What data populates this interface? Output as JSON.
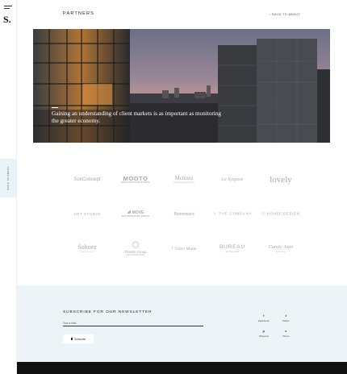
{
  "rail": {
    "logo": "S.",
    "back_tab": "BACK TO ABOUT"
  },
  "header": {
    "title": "PARTNERS",
    "back_link": "BACK TO ABOUT"
  },
  "hero": {
    "caption": "Gaining an understanding of client markets is as important as monitoring the greater economy."
  },
  "clients": {
    "row1": [
      "SonConcept",
      "MOOTO",
      "Mctinez",
      "Le Syspose",
      "lovely"
    ],
    "row1_sub": {
      "mooto": "ARCHITECTURE STUDIO",
      "mctinez": "INTERIOR DESIGN"
    },
    "row2": [
      "ART STUDIO",
      "MOVE",
      "Benimward",
      "THE COMPANY",
      "HOUSE DESIGN"
    ],
    "row2_sub": {
      "move": "ARCHITECTURE GROUP"
    },
    "row3": [
      "Sohoez",
      "Thaste Group",
      "Tailor Made",
      "BUREAU",
      "Candy Jane"
    ],
    "row3_sub": {
      "sohoez": "architecture",
      "thaste": "ARCHITECTURE",
      "bureau": "architecture",
      "candy": "STUDIO"
    }
  },
  "newsletter": {
    "title": "SUBSCRIBE FOR OUR NEWSLETTER",
    "email_placeholder": "Your e-mail...",
    "subscribe_label": "Subscribe"
  },
  "socials": [
    {
      "icon": "f",
      "label": "Facebook"
    },
    {
      "icon": "t",
      "label": "Twitter"
    },
    {
      "icon": "p",
      "label": "Pinterest"
    },
    {
      "icon": "v",
      "label": "Vimeo"
    }
  ],
  "colors": {
    "newsletter_bg": "#ecf4f7",
    "footer_bg": "#111111",
    "logo_gray": "#a9a9a9"
  }
}
